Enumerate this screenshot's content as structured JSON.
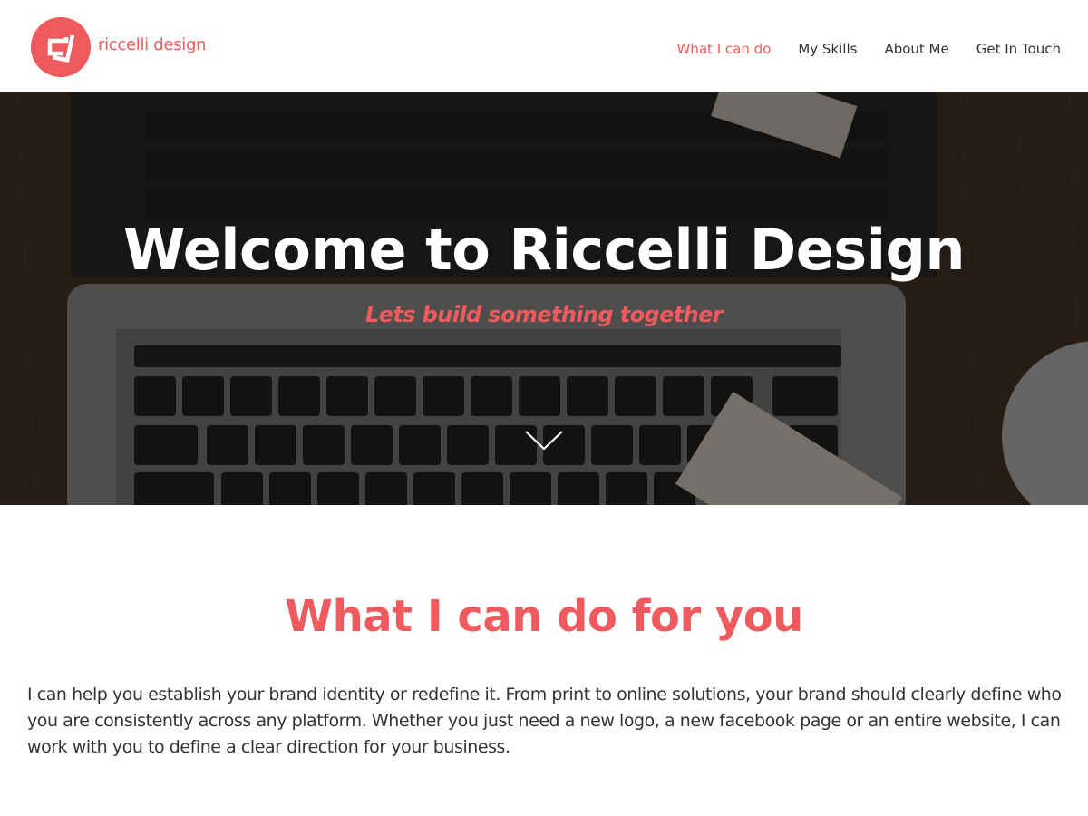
{
  "brand": {
    "name": "riccelli design",
    "accent_color": "#ef5a5e"
  },
  "nav": {
    "items": [
      {
        "label": "What I can do",
        "active": true
      },
      {
        "label": "My Skills",
        "active": false
      },
      {
        "label": "About Me",
        "active": false
      },
      {
        "label": "Get In Touch",
        "active": false
      }
    ]
  },
  "hero": {
    "title": "Welcome to Riccelli Design",
    "subtitle": "Lets build something together",
    "background": "laptop-keyboard-photo",
    "scroll_icon": "chevron-down-icon"
  },
  "section": {
    "title": "What I can do for you",
    "body": "I can help you establish your brand identity or redefine it. From print to online solutions, your brand should clearly define who you are consistently across any platform. Whether you just need a new logo, a new facebook page or an entire website, I can work with you to define a clear direction for your business."
  }
}
